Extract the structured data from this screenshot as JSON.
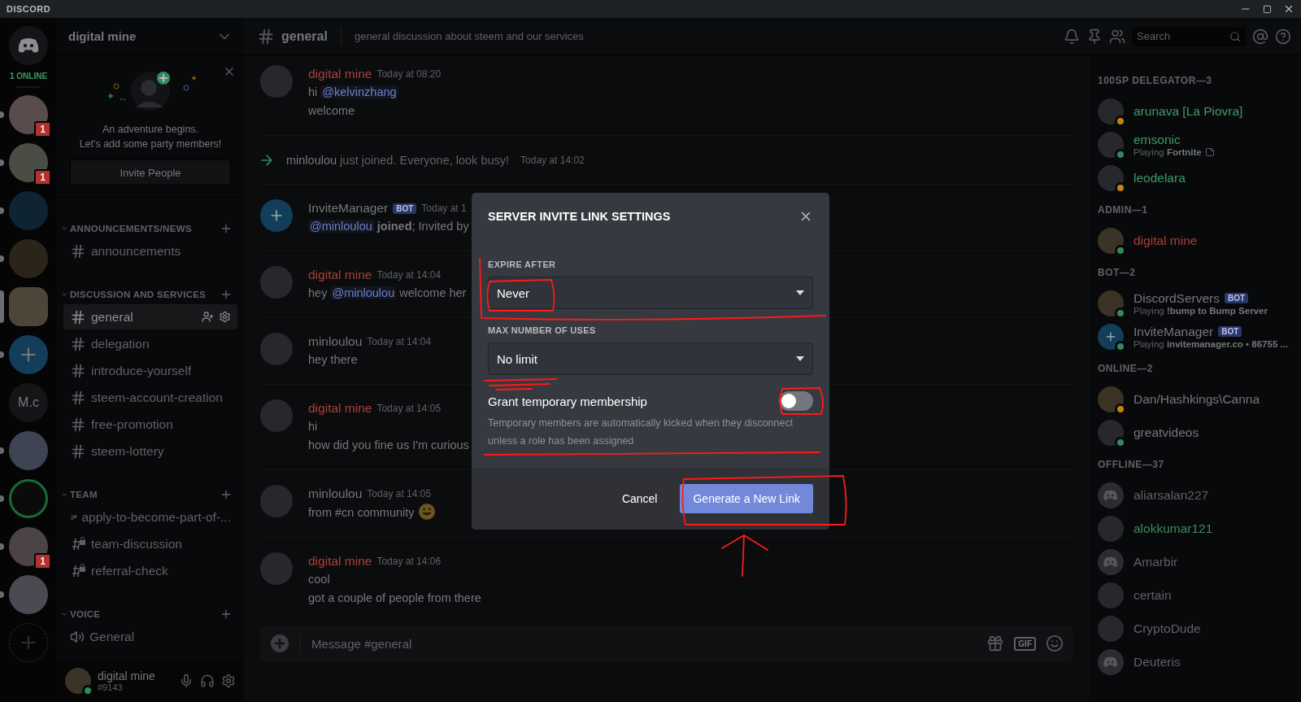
{
  "title_bar": {
    "app_name": "DISCORD"
  },
  "server_rail": {
    "online_label": "1 ONLINE",
    "servers": [
      {
        "kind": "image",
        "badge": "1",
        "unread": true,
        "selected": false
      },
      {
        "kind": "image",
        "badge": "1",
        "unread": true,
        "selected": false
      },
      {
        "kind": "image",
        "unread": true,
        "selected": false
      },
      {
        "kind": "image",
        "unread": true,
        "selected": false
      },
      {
        "kind": "image",
        "selected": true
      },
      {
        "kind": "bot",
        "unread": true,
        "selected": false
      },
      {
        "kind": "text",
        "label": "M.c",
        "selected": false
      },
      {
        "kind": "image",
        "unread": true,
        "selected": false
      },
      {
        "kind": "ring",
        "unread": true,
        "selected": false
      },
      {
        "kind": "image",
        "badge": "1",
        "unread": true,
        "selected": false
      },
      {
        "kind": "image",
        "unread": true,
        "selected": false
      }
    ]
  },
  "channel_sidebar": {
    "server_name": "digital mine",
    "invite_card": {
      "title": "An adventure begins.",
      "text": "Let's add some party members!",
      "button": "Invite People"
    },
    "categories": [
      {
        "name": "ANNOUNCEMENTS/NEWS",
        "channels": [
          {
            "name": "announcements",
            "kind": "text",
            "selected": false
          }
        ]
      },
      {
        "name": "DISCUSSION AND SERVICES",
        "channels": [
          {
            "name": "general",
            "kind": "text",
            "selected": true
          },
          {
            "name": "delegation",
            "kind": "text",
            "selected": false
          },
          {
            "name": "introduce-yourself",
            "kind": "text",
            "selected": false
          },
          {
            "name": "steem-account-creation",
            "kind": "text",
            "selected": false
          },
          {
            "name": "free-promotion",
            "kind": "text",
            "selected": false
          },
          {
            "name": "steem-lottery",
            "kind": "text",
            "selected": false
          }
        ]
      },
      {
        "name": "TEAM",
        "channels": [
          {
            "name": "apply-to-become-part-of-...",
            "kind": "locked",
            "selected": false
          },
          {
            "name": "team-discussion",
            "kind": "locked",
            "selected": false
          },
          {
            "name": "referral-check",
            "kind": "locked",
            "selected": false
          }
        ]
      },
      {
        "name": "VOICE",
        "channels": [
          {
            "name": "General",
            "kind": "voice",
            "selected": false
          }
        ]
      }
    ],
    "user_panel": {
      "name": "digital mine",
      "tag": "#9143"
    }
  },
  "chat_header": {
    "channel": "general",
    "topic": "general discussion about steem and our services",
    "search": {
      "placeholder": "Search"
    }
  },
  "messages": [
    {
      "kind": "message",
      "author": "digital mine",
      "color": "#a8413a",
      "time": "Today at 08:20",
      "lines": [
        [
          {
            "kind": "text",
            "text": "hi "
          },
          {
            "kind": "mention",
            "text": "@kelvinzhang"
          }
        ],
        [
          {
            "kind": "text",
            "text": "welcome"
          }
        ]
      ]
    },
    {
      "kind": "join",
      "user": "minloulou",
      "text": "just joined. Everyone, look busy!",
      "time": "Today at 14:02"
    },
    {
      "kind": "message",
      "author": "InviteManager",
      "color": "#75777b",
      "bot": "BOT",
      "time": "Today at 1",
      "lines": [
        [
          {
            "kind": "mention",
            "text": "@minloulou"
          },
          {
            "kind": "text",
            "text": " **joined**; Invited by"
          }
        ]
      ]
    },
    {
      "kind": "message",
      "author": "digital mine",
      "color": "#a8413a",
      "time": "Today at 14:04",
      "lines": [
        [
          {
            "kind": "text",
            "text": "hey "
          },
          {
            "kind": "mention",
            "text": "@minloulou"
          },
          {
            "kind": "text",
            "text": " welcome her"
          }
        ]
      ]
    },
    {
      "kind": "message",
      "author": "minloulou",
      "color": "#75777b",
      "time": "Today at 14:04",
      "lines": [
        [
          {
            "kind": "text",
            "text": "hey there"
          }
        ]
      ]
    },
    {
      "kind": "message",
      "author": "digital mine",
      "color": "#a8413a",
      "time": "Today at 14:05",
      "lines": [
        [
          {
            "kind": "text",
            "text": "hi"
          }
        ],
        [
          {
            "kind": "text",
            "text": "how did you fine us I'm curious"
          }
        ]
      ]
    },
    {
      "kind": "message",
      "author": "minloulou",
      "color": "#75777b",
      "time": "Today at 14:05",
      "lines": [
        [
          {
            "kind": "text",
            "text": "from #cn community "
          },
          {
            "kind": "emoji"
          }
        ]
      ]
    },
    {
      "kind": "message",
      "author": "digital mine",
      "color": "#a8413a",
      "time": "Today at 14:06",
      "lines": [
        [
          {
            "kind": "text",
            "text": "cool"
          }
        ],
        [
          {
            "kind": "text",
            "text": "got a couple of people from there"
          }
        ]
      ]
    }
  ],
  "composer": {
    "placeholder": "Message #general",
    "gif": "GIF"
  },
  "member_list": {
    "groups": [
      {
        "title": "100SP DELEGATOR—3",
        "members": [
          {
            "name": "arunava [La Piovra]",
            "color": "#3f9a6a",
            "online": true,
            "idle": true,
            "kind": "photo"
          },
          {
            "name": "emsonic",
            "color": "#3f9a6a",
            "online": true,
            "idle": false,
            "kind": "photo",
            "activity": "Playing **Fortnite**",
            "rich_presence": true
          },
          {
            "name": "leodelara",
            "color": "#3f9a6a",
            "online": true,
            "idle": true,
            "kind": "photo"
          }
        ]
      },
      {
        "title": "ADMIN—1",
        "members": [
          {
            "name": "digital mine",
            "color": "#a8413a",
            "online": true,
            "idle": false,
            "kind": "image"
          }
        ]
      },
      {
        "title": "BOT—2",
        "members": [
          {
            "name": "DiscordServers",
            "color": "#75777b",
            "online": true,
            "idle": false,
            "kind": "image",
            "bot": "BOT",
            "activity": "Playing **!bump to Bump Server**"
          },
          {
            "name": "InviteManager",
            "color": "#75777b",
            "online": true,
            "idle": false,
            "kind": "bot",
            "bot": "BOT",
            "activity": "Playing **invitemanager.co • 86755 ...**"
          }
        ]
      },
      {
        "title": "ONLINE—2",
        "members": [
          {
            "name": "Dan/Hashkings\\Canna",
            "color": "#75777b",
            "online": true,
            "idle": true,
            "kind": "image"
          },
          {
            "name": "greatvideos",
            "color": "#75777b",
            "online": true,
            "idle": false,
            "kind": "photo"
          }
        ]
      },
      {
        "title": "OFFLINE—37",
        "members": [
          {
            "name": "aliarsalan227",
            "color": "#5f6165",
            "online": false,
            "kind": "default"
          },
          {
            "name": "alokkumar121",
            "color": "#3a8a60",
            "online": false,
            "kind": "photo"
          },
          {
            "name": "Amarbir",
            "color": "#5f6165",
            "online": false,
            "kind": "default"
          },
          {
            "name": "certain",
            "color": "#5f6165",
            "online": false,
            "kind": "photo"
          },
          {
            "name": "CryptoDude",
            "color": "#5f6165",
            "online": false,
            "kind": "photo"
          },
          {
            "name": "Deuteris",
            "color": "#5f6165",
            "online": false,
            "kind": "default"
          }
        ]
      }
    ]
  },
  "modal": {
    "title": "SERVER INVITE LINK SETTINGS",
    "fields": [
      {
        "label": "EXPIRE AFTER",
        "value": "Never"
      },
      {
        "label": "MAX NUMBER OF USES",
        "value": "No limit"
      }
    ],
    "toggle": {
      "label": "Grant temporary membership",
      "on": false,
      "description": "Temporary members are automatically kicked when they disconnect unless a role has been assigned"
    },
    "cancel": "Cancel",
    "confirm": "Generate a New Link"
  }
}
